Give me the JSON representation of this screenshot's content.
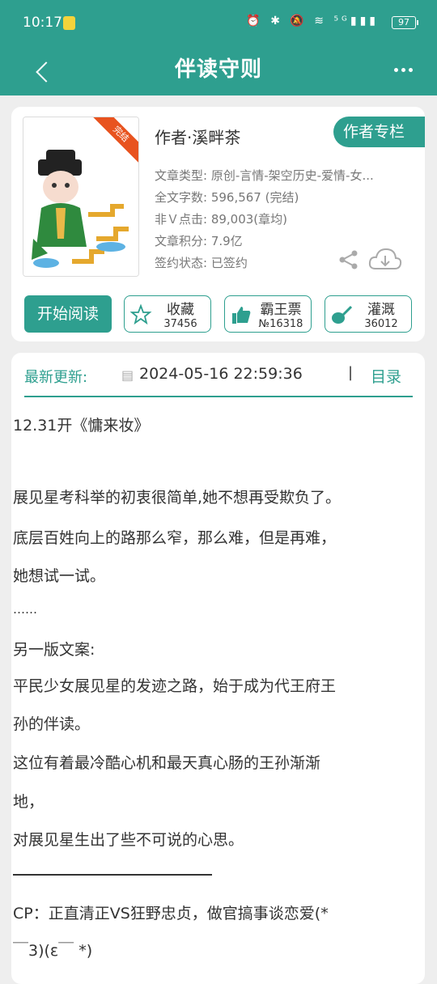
{
  "status": {
    "time": "10:17",
    "icons": "⏰ ✱ 🔕 ≋ ⁵ᴳ▮▮▮",
    "battery": "97"
  },
  "appbar": {
    "title": "伴读守则"
  },
  "book": {
    "cover_badge": "完结",
    "author": "作者·溪畔茶",
    "author_column_btn": "作者专栏",
    "meta": [
      "文章类型: 原创-言情-架空历史-爱情-女...",
      "全文字数: 596,567 (完结)",
      "非Ｖ点击: 89,003(章均)",
      "文章积分: 7.9亿",
      "签约状态: 已签约"
    ]
  },
  "actions": {
    "start_reading": "开始阅读",
    "favorite": {
      "label": "收藏",
      "count": "37456"
    },
    "ticket": {
      "label": "霸王票",
      "count": "№16318"
    },
    "water": {
      "label": "灌溉",
      "count": "36012"
    }
  },
  "update": {
    "label": "最新更新:",
    "mark": "▤",
    "time": "2024-05-16 22:59:36",
    "sep": "|",
    "toc": "目录"
  },
  "description": [
    "12.31开《慵来妆》",
    "展见星考科举的初衷很简单,她不想再受欺负了。",
    "底层百姓向上的路那么窄，那么难，但是再难，",
    "她想试一试。",
    "……",
    "另一版文案:",
    "平民少女展见星的发迹之路，始于成为代王府王",
    "孙的伴读。",
    "这位有着最冷酷心机和最天真心肠的王孙渐渐",
    "地，",
    "对展见星生出了些不可说的心思。",
    "CP：正直清正VS狂野忠贞，做官搞事谈恋爱(*",
    "￣3)(ε￣ *)"
  ],
  "colors": {
    "accent": "#2e9f8f",
    "badge": "#e8531f"
  }
}
